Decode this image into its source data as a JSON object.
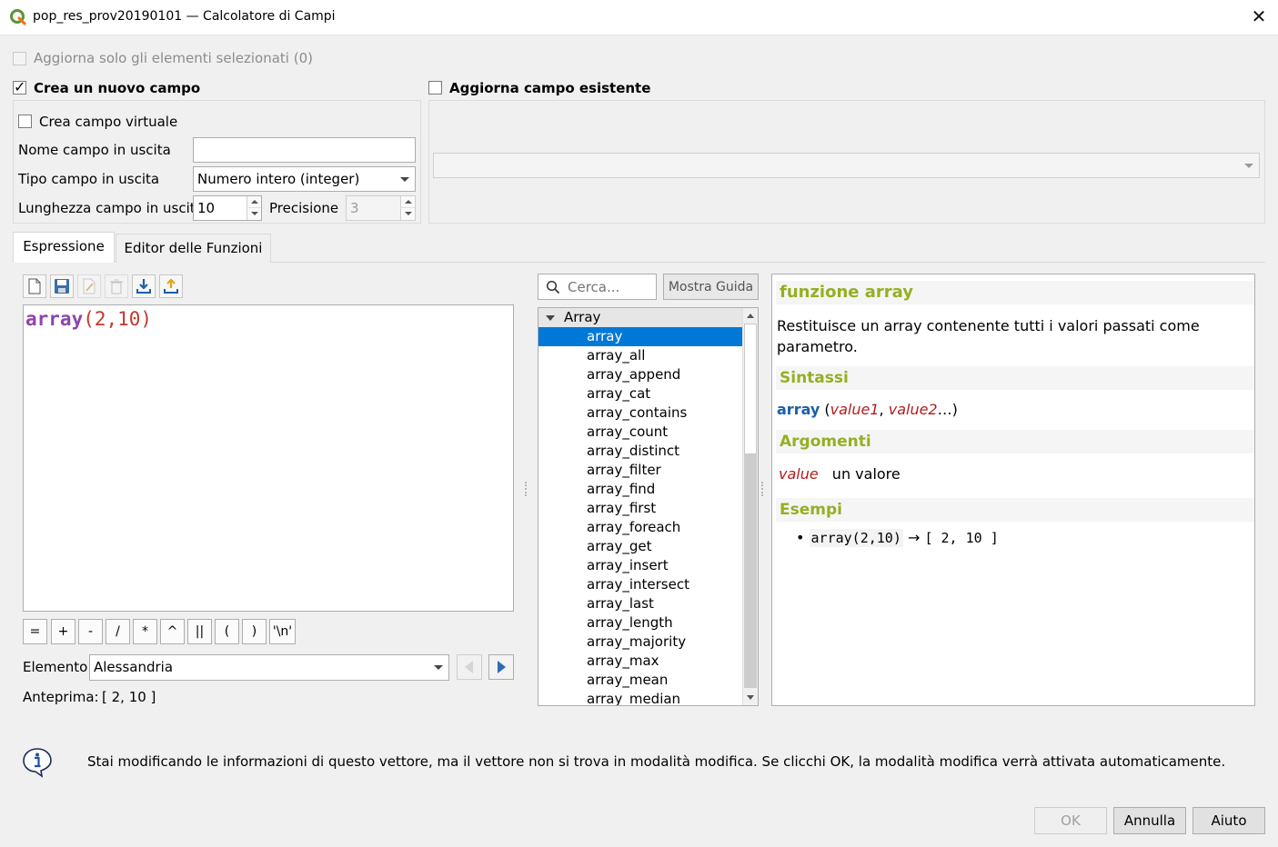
{
  "window": {
    "title": "pop_res_prov20190101 — Calcolatore di Campi",
    "close_glyph": "✕"
  },
  "options": {
    "update_selected_label": "Aggiorna solo gli elementi selezionati (0)",
    "create_new_field_label": "Crea un nuovo campo",
    "create_new_field_checked": true,
    "update_existing_label": "Aggiorna campo esistente",
    "update_existing_checked": false
  },
  "new_field": {
    "virtual_label": "Crea campo virtuale",
    "name_label": "Nome campo in uscita",
    "name_value": "",
    "type_label": "Tipo campo in uscita",
    "type_value": "Numero intero (integer)",
    "length_label": "Lunghezza campo in uscita",
    "length_value": "10",
    "precision_label": "Precisione",
    "precision_value": "3"
  },
  "existing_field": {
    "selected": ""
  },
  "tabs": [
    {
      "label": "Espressione",
      "active": true
    },
    {
      "label": "Editor delle Funzioni",
      "active": false
    }
  ],
  "toolbar_icons": [
    "new-file-icon",
    "save-icon",
    "edit-icon",
    "delete-icon",
    "import-icon",
    "export-icon"
  ],
  "expression": {
    "func": "array",
    "args": "(2,10)",
    "func_color": "#8e44ad",
    "args_color": "#c0392b"
  },
  "operators": [
    "=",
    "+",
    "-",
    "/",
    "*",
    "^",
    "||",
    "(",
    ")",
    "'\\n'"
  ],
  "feature": {
    "label": "Elemento",
    "value": "Alessandria",
    "preview_label": "Anteprima:",
    "preview_value": "[ 2, 10 ]"
  },
  "search": {
    "placeholder": "Cerca...",
    "show_help_label": "Mostra Guida"
  },
  "function_tree": {
    "group": "Array",
    "items": [
      "array",
      "array_all",
      "array_append",
      "array_cat",
      "array_contains",
      "array_count",
      "array_distinct",
      "array_filter",
      "array_find",
      "array_first",
      "array_foreach",
      "array_get",
      "array_insert",
      "array_intersect",
      "array_last",
      "array_length",
      "array_majority",
      "array_max",
      "array_mean",
      "array_median"
    ],
    "selected": "array"
  },
  "help": {
    "title": "funzione array",
    "description": "Restituisce un array contenente tutti i valori passati come parametro.",
    "syntax_heading": "Sintassi",
    "syntax_func": "array",
    "syntax_open": "(",
    "syntax_arg1": "value1",
    "syntax_sep": ", ",
    "syntax_arg2": "value2",
    "syntax_close": "…)",
    "arguments_heading": "Argomenti",
    "arg_name": "value",
    "arg_desc": "un valore",
    "examples_heading": "Esempi",
    "example_code": "array(2,10)",
    "example_arrow": "→",
    "example_result": "[ 2, 10 ]",
    "heading_color": "#93b023",
    "func_color": "#1a5fa8",
    "arg_color": "#b01e1e"
  },
  "message": {
    "text": "Stai modificando le informazioni di questo vettore, ma il vettore non si trova in modalità modifica. Se clicchi OK, la modalità modifica verrà attivata automaticamente."
  },
  "buttons": {
    "ok": "OK",
    "cancel": "Annulla",
    "help": "Aiuto"
  }
}
